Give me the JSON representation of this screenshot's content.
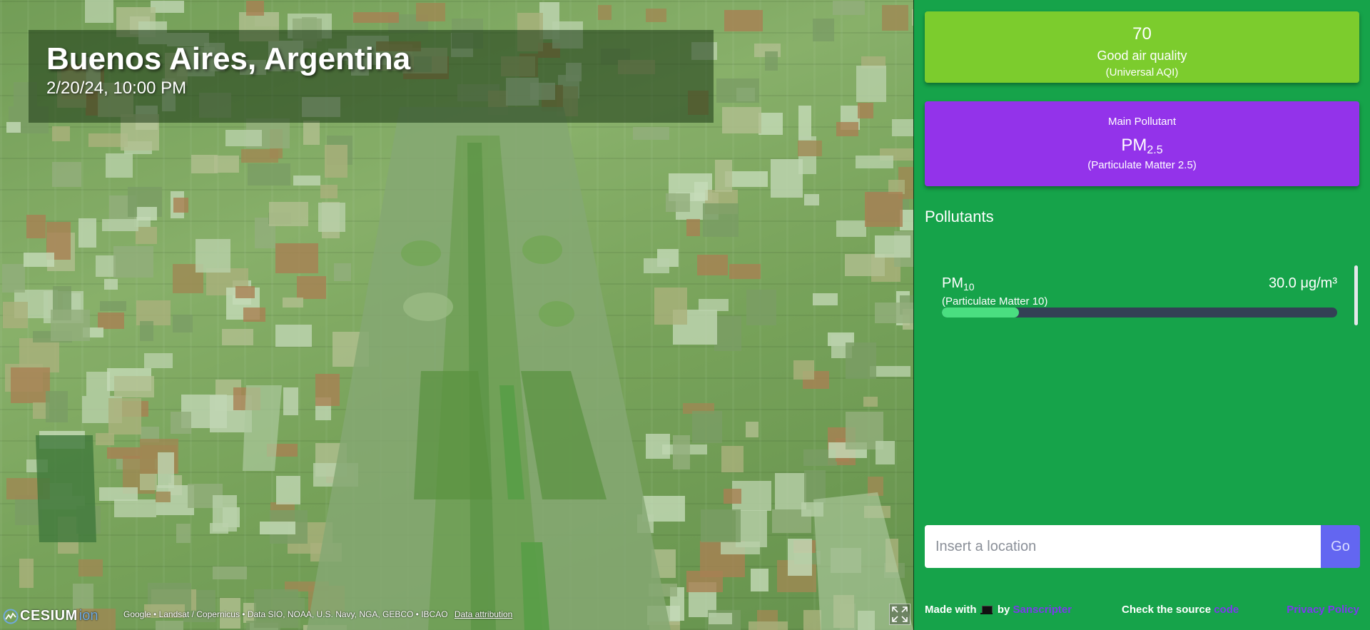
{
  "location": {
    "title": "Buenos Aires, Argentina",
    "datetime": "2/20/24, 10:00 PM"
  },
  "map": {
    "logo_word": "CESIUM",
    "logo_ion": "ion",
    "credits": "Google • Landsat / Copernicus • Data SIO, NOAA, U.S. Navy, NGA, GEBCO • IBCAO",
    "data_attribution": "Data attribution",
    "fullscreen_icon": "fullscreen-icon",
    "tint_color": "#22c55e"
  },
  "aqi": {
    "value": "70",
    "label": "Good air quality",
    "scale": "(Universal AQI)",
    "color": "#7ccc2d"
  },
  "main_pollutant": {
    "title": "Main Pollutant",
    "symbol": "PM",
    "subscript": "2.5",
    "full_name": "(Particulate Matter 2.5)",
    "color": "#9333ea"
  },
  "pollutants": {
    "heading": "Pollutants",
    "items": [
      {
        "symbol": "PM",
        "subscript": "10",
        "full_name": "(Particulate Matter 10)",
        "value": "30.0 μg/m³",
        "level_fraction": 0.195
      }
    ]
  },
  "search": {
    "placeholder": "Insert a location",
    "value": "",
    "button_label": "Go"
  },
  "footer": {
    "made_with": "Made with",
    "by": "by",
    "author": "Sanscripter",
    "source_text": "Check the source",
    "source_link": "code",
    "privacy": "Privacy Policy"
  },
  "colors": {
    "panel_bg": "#16a34a",
    "link": "#7c3aed",
    "go_button": "#6366f1"
  }
}
